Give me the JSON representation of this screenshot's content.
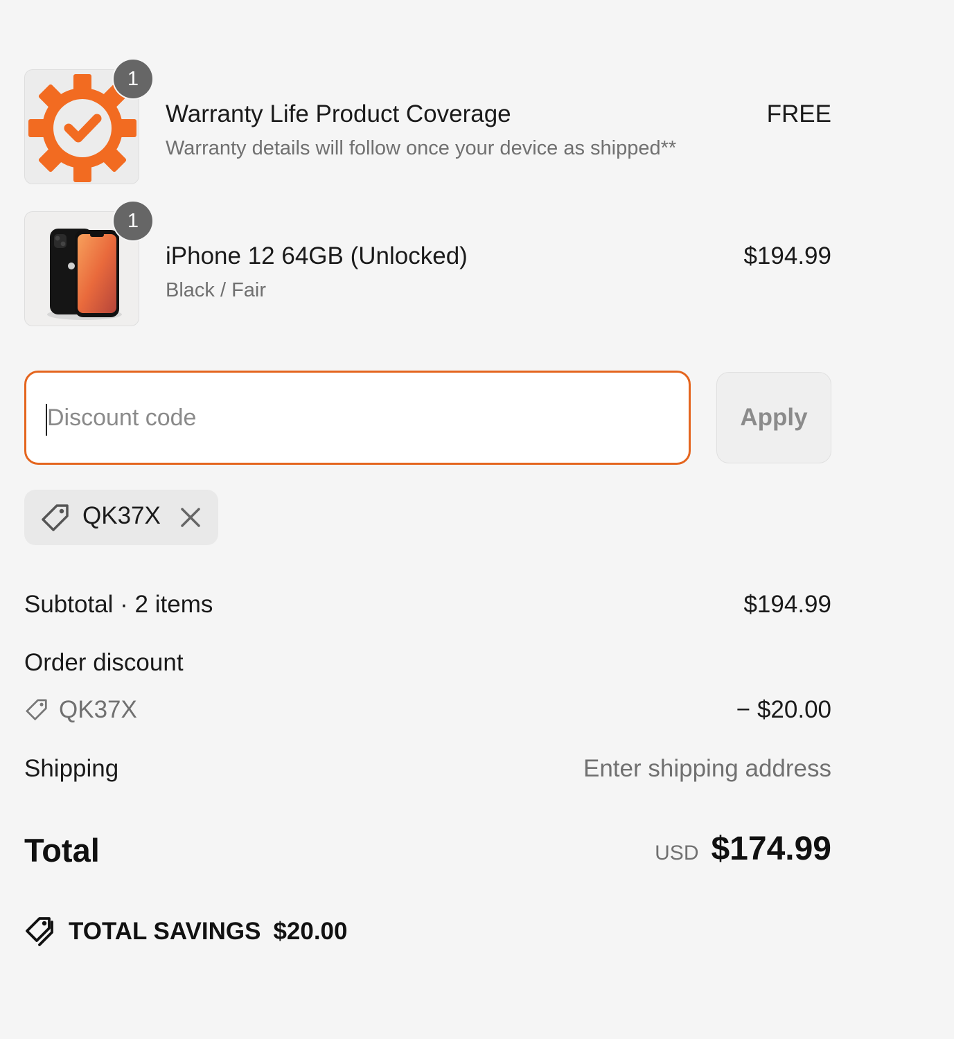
{
  "cart": {
    "items": [
      {
        "quantity": "1",
        "title": "Warranty Life Product Coverage",
        "subtitle": "Warranty details will follow once your device as shipped**",
        "price": "FREE",
        "image": "orange-gear-checkmark-icon"
      },
      {
        "quantity": "1",
        "title": "iPhone 12 64GB (Unlocked)",
        "subtitle": "Black / Fair",
        "price": "$194.99",
        "image": "black-iphone-12-photo"
      }
    ]
  },
  "discount": {
    "placeholder": "Discount code",
    "value": "",
    "apply_label": "Apply",
    "applied_code": "QK37X"
  },
  "summary": {
    "subtotal_label": "Subtotal · 2 items",
    "subtotal_value": "$194.99",
    "order_discount_label": "Order discount",
    "discount_code": "QK37X",
    "discount_value": "− $20.00",
    "shipping_label": "Shipping",
    "shipping_value": "Enter shipping address",
    "total_label": "Total",
    "currency": "USD",
    "total_value": "$174.99",
    "savings_label": "TOTAL SAVINGS",
    "savings_value": "$20.00"
  },
  "colors": {
    "accent": "#e4651e",
    "background": "#f5f5f5",
    "badge": "#666666",
    "muted_text": "#707070"
  }
}
